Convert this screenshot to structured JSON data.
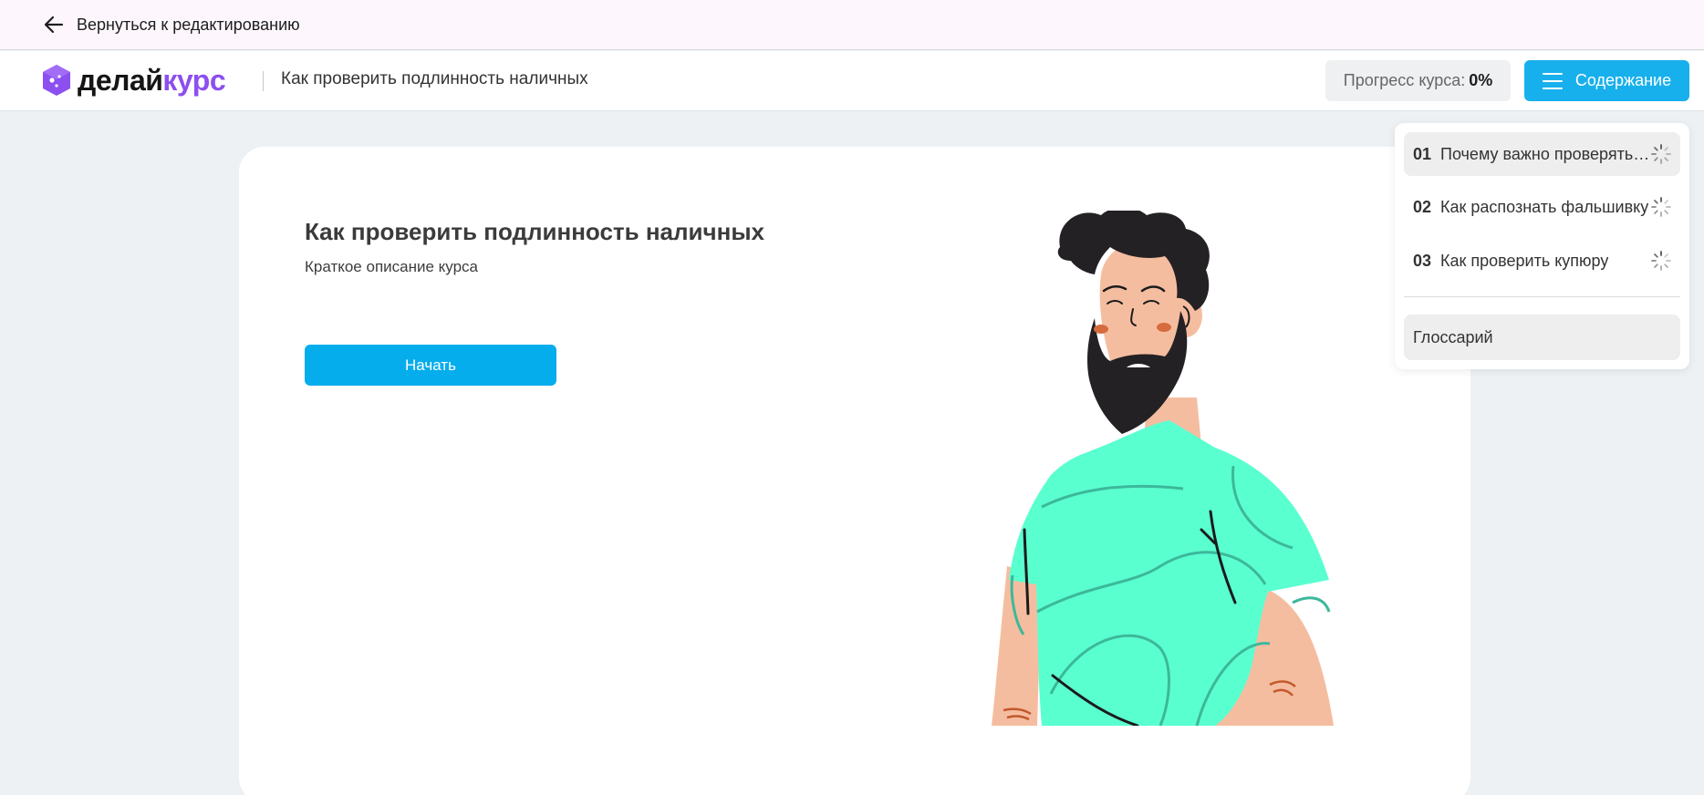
{
  "edit_bar": {
    "back_label": "Вернуться к редактированию",
    "back_icon": "arrow-left-icon"
  },
  "header": {
    "logo_part1": "делай",
    "logo_part2": "курс",
    "course_title": "Как проверить подлинность наличных",
    "progress_label": "Прогресс курса:",
    "progress_value": "0%",
    "contents_label": "Содержание",
    "contents_icon": "menu-icon"
  },
  "card": {
    "title": "Как проверить подлинность наличных",
    "description": "Краткое описание курса",
    "start_label": "Начать"
  },
  "contents": {
    "items": [
      {
        "num": "01",
        "label": "Почему важно проверять наличные",
        "active": true,
        "status_icon": "spinner-icon"
      },
      {
        "num": "02",
        "label": "Как распознать фальшивку",
        "active": false,
        "status_icon": "spinner-icon"
      },
      {
        "num": "03",
        "label": "Как проверить купюру",
        "active": false,
        "status_icon": "spinner-icon"
      }
    ],
    "glossary_label": "Глоссарий"
  },
  "colors": {
    "accent": "#17b0ec",
    "brand_purple": "#8c4ff0",
    "shirt": "#5affd0",
    "skin": "#f5bda0",
    "hair": "#242124"
  }
}
